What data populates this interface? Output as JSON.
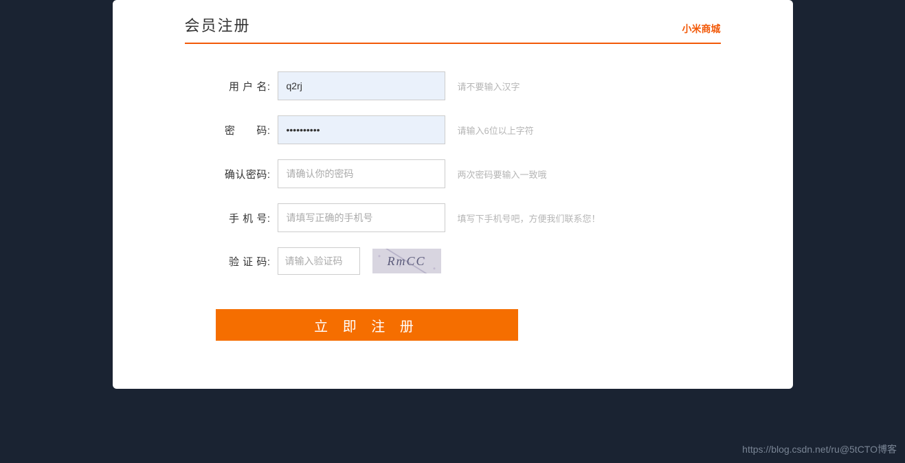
{
  "header": {
    "title": "会员注册",
    "mall_link": "小米商城"
  },
  "form": {
    "username": {
      "label": "用 户 名:",
      "value": "q2rj",
      "hint": "请不要输入汉字"
    },
    "password": {
      "label": "密  码:",
      "value": "••••••••••",
      "hint": "请输入6位以上字符"
    },
    "confirm": {
      "label": "确认密码:",
      "placeholder": "请确认你的密码",
      "hint": "两次密码要输入一致哦"
    },
    "phone": {
      "label": "手 机 号:",
      "placeholder": "请填写正确的手机号",
      "hint": "填写下手机号吧，方便我们联系您！"
    },
    "captcha": {
      "label": "验 证 码:",
      "placeholder": "请输入验证码",
      "image_text": "RmCC"
    },
    "submit": "立 即 注 册"
  },
  "watermark": "https://blog.csdn.net/ru@5tCTO博客"
}
